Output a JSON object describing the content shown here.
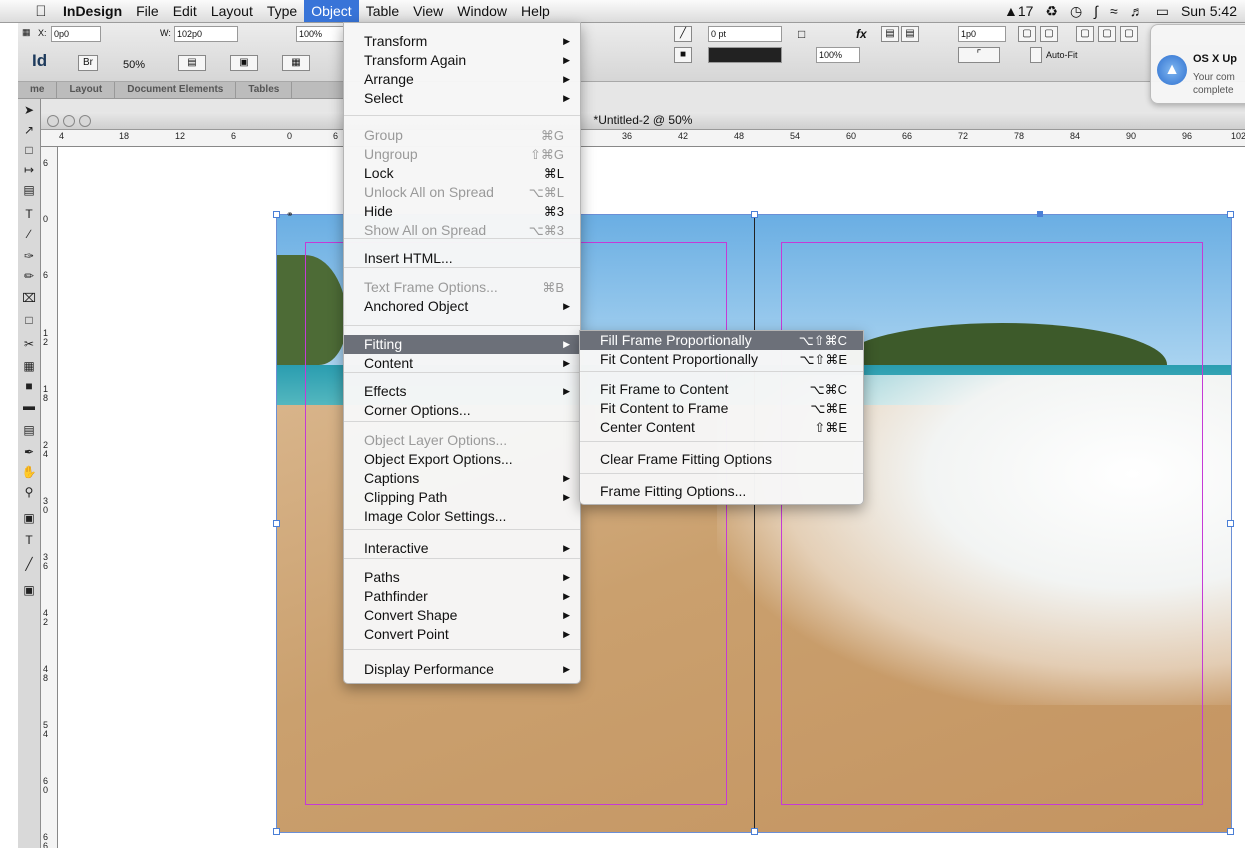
{
  "menubar": {
    "apple": "",
    "items": [
      "InDesign",
      "File",
      "Edit",
      "Layout",
      "Type",
      "Object",
      "Table",
      "View",
      "Window",
      "Help"
    ],
    "status": {
      "adobe": "17",
      "clock": "Sun 5:42"
    }
  },
  "control": {
    "x_label": "X:",
    "x_value": "0p0",
    "w_label": "W:",
    "w_value": "102p0",
    "scale": "100%",
    "stroke_weight": "0 pt",
    "opacity": "100%",
    "gutter": "1p0",
    "autofit_label": "Auto-Fit",
    "zoom": "50%",
    "app_logo": "Id",
    "bridge": "Br"
  },
  "tabs": [
    "me",
    "Layout",
    "Document Elements",
    "Tables"
  ],
  "notification": {
    "title": "OS X Up",
    "body_line1": "Your com",
    "body_line2": "complete"
  },
  "document": {
    "title": "*Untitled-2 @ 50%"
  },
  "rulers": {
    "h": [
      "4",
      "18",
      "12",
      "6",
      "0",
      "6",
      "36",
      "42",
      "48",
      "54",
      "60",
      "66",
      "72",
      "78",
      "84",
      "90",
      "96",
      "102"
    ],
    "v": [
      "6",
      "0",
      "6",
      "1\n2",
      "1\n8",
      "2\n4",
      "3\n0",
      "3\n6",
      "4\n2",
      "4\n8",
      "5\n4",
      "6\n0",
      "6\n6"
    ]
  },
  "object_menu": {
    "items": [
      {
        "label": "Transform",
        "shortcut": "",
        "sub": true,
        "disabled": false
      },
      {
        "label": "Transform Again",
        "shortcut": "",
        "sub": true,
        "disabled": false
      },
      {
        "label": "Arrange",
        "shortcut": "",
        "sub": true,
        "disabled": false
      },
      {
        "label": "Select",
        "shortcut": "",
        "sub": true,
        "disabled": false
      },
      {
        "label": "Group",
        "shortcut": "⌘G",
        "sub": false,
        "disabled": true
      },
      {
        "label": "Ungroup",
        "shortcut": "⇧⌘G",
        "sub": false,
        "disabled": true
      },
      {
        "label": "Lock",
        "shortcut": "⌘L",
        "sub": false,
        "disabled": false
      },
      {
        "label": "Unlock All on Spread",
        "shortcut": "⌥⌘L",
        "sub": false,
        "disabled": true
      },
      {
        "label": "Hide",
        "shortcut": "⌘3",
        "sub": false,
        "disabled": false
      },
      {
        "label": "Show All on Spread",
        "shortcut": "⌥⌘3",
        "sub": false,
        "disabled": true
      },
      {
        "label": "Insert HTML...",
        "shortcut": "",
        "sub": false,
        "disabled": false
      },
      {
        "label": "Text Frame Options...",
        "shortcut": "⌘B",
        "sub": false,
        "disabled": true
      },
      {
        "label": "Anchored Object",
        "shortcut": "",
        "sub": true,
        "disabled": false
      },
      {
        "label": "Fitting",
        "shortcut": "",
        "sub": true,
        "disabled": false,
        "highlighted": true
      },
      {
        "label": "Content",
        "shortcut": "",
        "sub": true,
        "disabled": false
      },
      {
        "label": "Effects",
        "shortcut": "",
        "sub": true,
        "disabled": false
      },
      {
        "label": "Corner Options...",
        "shortcut": "",
        "sub": false,
        "disabled": false
      },
      {
        "label": "Object Layer Options...",
        "shortcut": "",
        "sub": false,
        "disabled": true
      },
      {
        "label": "Object Export Options...",
        "shortcut": "",
        "sub": false,
        "disabled": false
      },
      {
        "label": "Captions",
        "shortcut": "",
        "sub": true,
        "disabled": false
      },
      {
        "label": "Clipping Path",
        "shortcut": "",
        "sub": true,
        "disabled": false
      },
      {
        "label": "Image Color Settings...",
        "shortcut": "",
        "sub": false,
        "disabled": false
      },
      {
        "label": "Interactive",
        "shortcut": "",
        "sub": true,
        "disabled": false
      },
      {
        "label": "Paths",
        "shortcut": "",
        "sub": true,
        "disabled": false
      },
      {
        "label": "Pathfinder",
        "shortcut": "",
        "sub": true,
        "disabled": false
      },
      {
        "label": "Convert Shape",
        "shortcut": "",
        "sub": true,
        "disabled": false
      },
      {
        "label": "Convert Point",
        "shortcut": "",
        "sub": true,
        "disabled": false
      },
      {
        "label": "Display Performance",
        "shortcut": "",
        "sub": true,
        "disabled": false
      }
    ]
  },
  "fitting_submenu": {
    "items": [
      {
        "label": "Fill Frame Proportionally",
        "shortcut": "⌥⇧⌘C",
        "highlighted": true
      },
      {
        "label": "Fit Content Proportionally",
        "shortcut": "⌥⇧⌘E"
      },
      {
        "label": "Fit Frame to Content",
        "shortcut": "⌥⌘C"
      },
      {
        "label": "Fit Content to Frame",
        "shortcut": "⌥⌘E"
      },
      {
        "label": "Center Content",
        "shortcut": "⇧⌘E"
      },
      {
        "label": "Clear Frame Fitting Options",
        "shortcut": ""
      },
      {
        "label": "Frame Fitting Options...",
        "shortcut": ""
      }
    ]
  },
  "colors": {
    "menu_highlight": "#6c7079",
    "selection": "#4a7fd6",
    "margin": "#c53ad6"
  }
}
